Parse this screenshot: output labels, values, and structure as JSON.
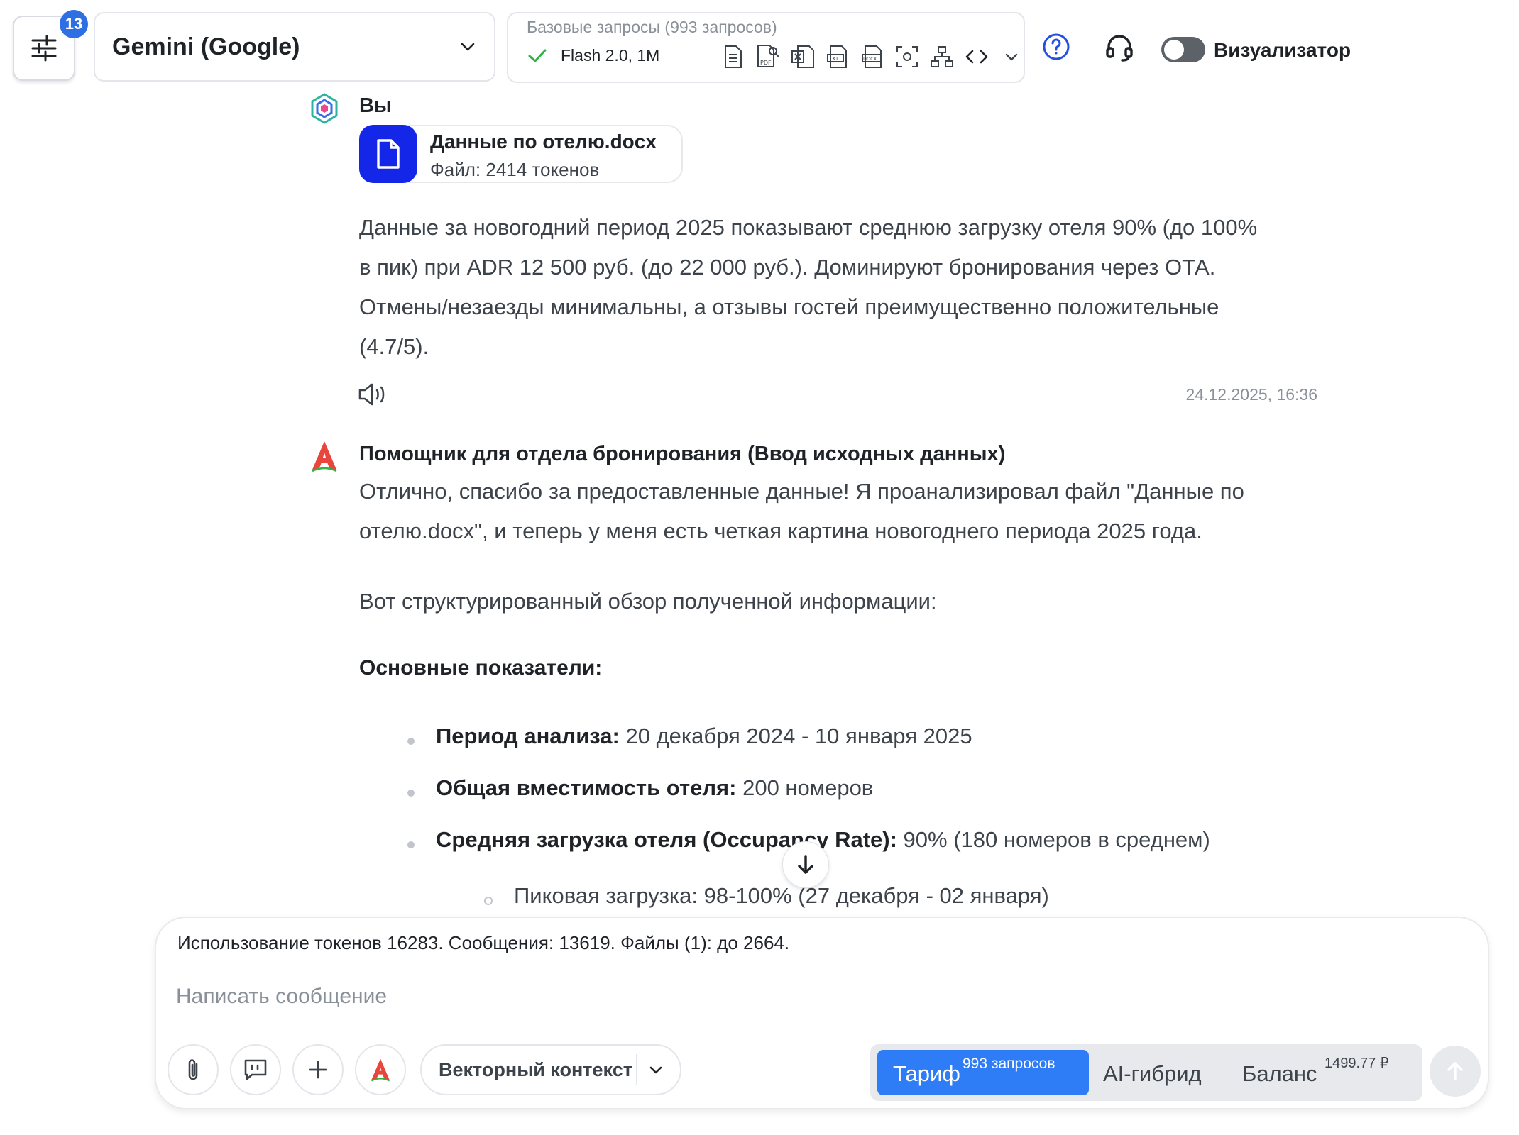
{
  "header": {
    "filter_badge": "13",
    "model_name": "Gemini (Google)",
    "plan_title": "Базовые запросы (993 запросов)",
    "plan_name": "Flash 2.0, 1M",
    "visualizer_label": "Визуализатор",
    "visualizer_on": false
  },
  "messages": {
    "user": {
      "sender": "Вы",
      "file_name": "Данные по отелю.docx",
      "file_tokens": "Файл: 2414 токенов",
      "lines": [
        "Данные за новогодний период 2025 показывают среднюю загрузку отеля 90% (до 100%",
        "в пик) при ADR 12 500 руб. (до 22 000 руб.). Доминируют бронирования через ОТА.",
        "Отмены/незаезды минимальны, а отзывы гостей преимущественно положительные",
        "(4.7/5)."
      ],
      "timestamp": "24.12.2025, 16:36"
    },
    "assistant": {
      "sender": "Помощник для отдела бронирования (Ввод исходных данных)",
      "intro_lines": [
        "Отлично, спасибо за предоставленные данные! Я проанализировал файл \"Данные по",
        "отелю.docx\", и теперь у меня есть четкая картина новогоднего периода 2025 года."
      ],
      "overview": "Вот структурированный обзор полученной информации:",
      "section_title": "Основные показатели:",
      "bullets": [
        {
          "label": "Период анализа:",
          "value": " 20 декабря 2024 - 10 января 2025"
        },
        {
          "label": "Общая вместимость отеля:",
          "value": " 200 номеров"
        },
        {
          "label": "Средняя загрузка отеля (Occupancy Rate):",
          "value": " 90% (180 номеров в среднем)"
        }
      ],
      "sub_bullet": "Пиковая загрузка: 98-100% (27 декабря - 02 января)"
    }
  },
  "composer": {
    "usage": "Использование токенов 16283. Сообщения: 13619. Файлы (1): до 2664.",
    "placeholder": "Написать сообщение",
    "context_label": "Векторный контекст",
    "modes": {
      "tarif_label": "Тариф",
      "tarif_sup": "993 запросов",
      "hybrid_label": "AI-гибрид",
      "balance_label": "Баланс",
      "balance_sup": "1499.77 ₽"
    }
  },
  "colors": {
    "accent_blue": "#2f7df6",
    "file_icon_bg": "#1426e8",
    "badge_blue": "#2f6fe4",
    "check_green": "#2fb344",
    "assistant_logo_red": "#e8453c"
  }
}
